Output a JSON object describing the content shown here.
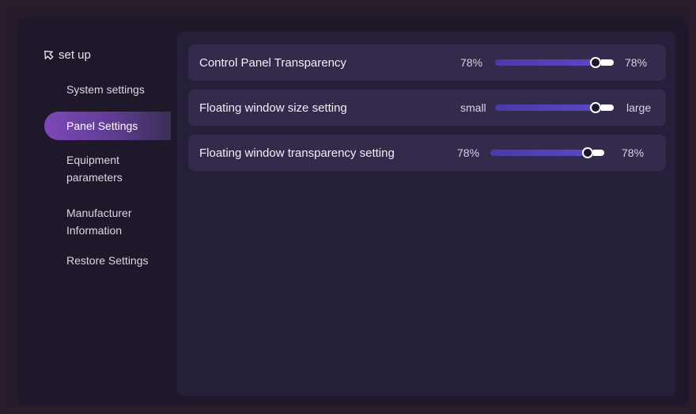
{
  "sidebar": {
    "title": "set up",
    "items": [
      {
        "label": "System settings"
      },
      {
        "label": "Panel Settings"
      },
      {
        "label": "Equipment parameters"
      },
      {
        "label": "Manufacturer Information"
      },
      {
        "label": "Restore Settings"
      }
    ],
    "active_index": 1
  },
  "settings": [
    {
      "label": "Control Panel Transparency",
      "min_label": "78%",
      "max_label": "78%",
      "value_fraction": 0.85
    },
    {
      "label": "Floating window size setting",
      "min_label": "small",
      "max_label": "large",
      "value_fraction": 0.85
    },
    {
      "label": "Floating window transparency setting",
      "min_label": "78%",
      "max_label": "78%",
      "value_fraction": 0.85
    }
  ],
  "icons": {
    "back": "back-arrow-icon"
  },
  "colors": {
    "accent": "#7c49b8",
    "track": "#5a48c8"
  }
}
